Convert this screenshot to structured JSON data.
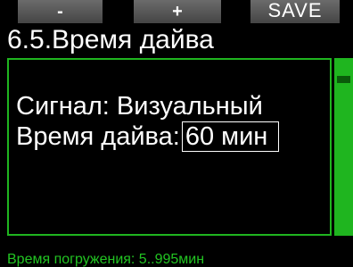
{
  "softkeys": {
    "minus_label": "-",
    "plus_label": "+",
    "save_label": "SAVE"
  },
  "header": {
    "title": "6.5.Время дайва"
  },
  "settings": {
    "signal_label": "Сигнал:",
    "signal_value": "Визуальный",
    "dive_time_label": "Время дайва:",
    "dive_time_value": "60 мин"
  },
  "status": {
    "text": "Время погружения: 5..995мин"
  },
  "colors": {
    "accent": "#1fb51f",
    "background": "#000000",
    "softkey": "#5a5a5a",
    "text": "#ffffff"
  }
}
